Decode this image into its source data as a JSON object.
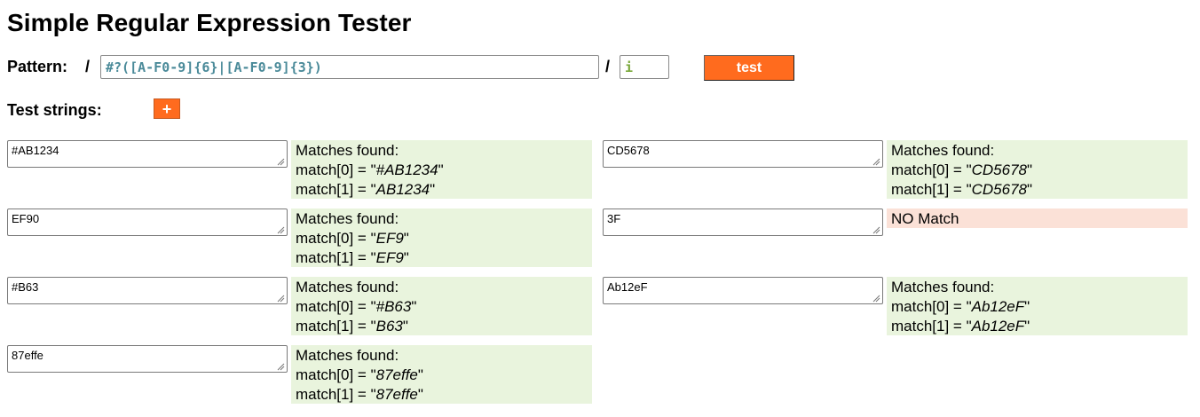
{
  "title": "Simple Regular Expression Tester",
  "pattern": {
    "label": "Pattern:",
    "open_slash": "/",
    "value": "#?([A-F0-9]{6}|[A-F0-9]{3})",
    "close_slash": "/",
    "flags": "i"
  },
  "test_button_label": "test",
  "test_strings_label": "Test strings:",
  "add_button_label": "+",
  "colors": {
    "accent": "#ff6b1e",
    "match_bg": "#e9f4dd",
    "nomatch_bg": "#fbe1d7",
    "pattern_text": "#4a8a99",
    "flags_text": "#79a83a"
  },
  "tests": [
    {
      "input": "#AB1234",
      "matched": true,
      "header": "Matches found:",
      "m0_prefix": "match[0] = \"",
      "m0": "#AB1234",
      "m1_prefix": "match[1] = \"",
      "m1": "AB1234",
      "suffix": "\""
    },
    {
      "input": "CD5678",
      "matched": true,
      "header": "Matches found:",
      "m0_prefix": "match[0] = \"",
      "m0": "CD5678",
      "m1_prefix": "match[1] = \"",
      "m1": "CD5678",
      "suffix": "\""
    },
    {
      "input": "EF90",
      "matched": true,
      "header": "Matches found:",
      "m0_prefix": "match[0] = \"",
      "m0": "EF9",
      "m1_prefix": "match[1] = \"",
      "m1": "EF9",
      "suffix": "\""
    },
    {
      "input": "3F",
      "matched": false,
      "header": "NO Match"
    },
    {
      "input": "#B63",
      "matched": true,
      "header": "Matches found:",
      "m0_prefix": "match[0] = \"",
      "m0": "#B63",
      "m1_prefix": "match[1] = \"",
      "m1": "B63",
      "suffix": "\""
    },
    {
      "input": "Ab12eF",
      "matched": true,
      "header": "Matches found:",
      "m0_prefix": "match[0] = \"",
      "m0": "Ab12eF",
      "m1_prefix": "match[1] = \"",
      "m1": "Ab12eF",
      "suffix": "\""
    },
    {
      "input": "87effe",
      "matched": true,
      "header": "Matches found:",
      "m0_prefix": "match[0] = \"",
      "m0": "87effe",
      "m1_prefix": "match[1] = \"",
      "m1": "87effe",
      "suffix": "\""
    }
  ]
}
